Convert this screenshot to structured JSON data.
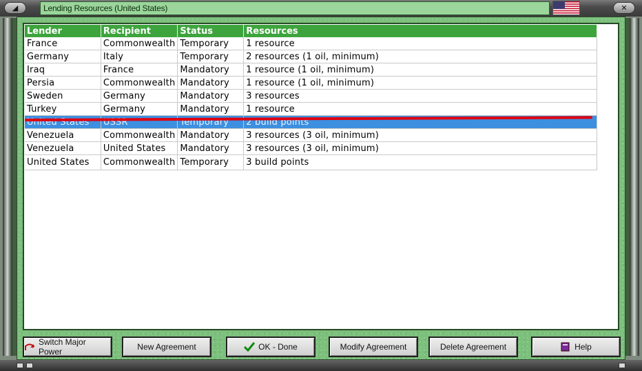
{
  "window": {
    "title": "Lending Resources (United States)",
    "left_button_icon": "window-menu-icon",
    "right_button_icon": "close-icon",
    "flag_icon": "us-flag-icon"
  },
  "table": {
    "headers": [
      "Lender",
      "Recipient",
      "Status",
      "Resources"
    ],
    "rows": [
      {
        "lender": "France",
        "recipient": "Commonwealth",
        "status": "Temporary",
        "resources": "1 resource"
      },
      {
        "lender": "Germany",
        "recipient": "Italy",
        "status": "Temporary",
        "resources": "2 resources (1 oil, minimum)"
      },
      {
        "lender": "Iraq",
        "recipient": "France",
        "status": "Mandatory",
        "resources": "1 resource (1 oil, minimum)"
      },
      {
        "lender": "Persia",
        "recipient": "Commonwealth",
        "status": "Mandatory",
        "resources": "1 resource (1 oil, minimum)"
      },
      {
        "lender": "Sweden",
        "recipient": "Germany",
        "status": "Mandatory",
        "resources": "3 resources"
      },
      {
        "lender": "Turkey",
        "recipient": "Germany",
        "status": "Mandatory",
        "resources": "1 resource"
      },
      {
        "lender": "United States",
        "recipient": "USSR",
        "status": "Temporary",
        "resources": "2 build points",
        "selected": true
      },
      {
        "lender": "Venezuela",
        "recipient": "Commonwealth",
        "status": "Mandatory",
        "resources": "3 resources (3 oil, minimum)"
      },
      {
        "lender": "Venezuela",
        "recipient": "United States",
        "status": "Mandatory",
        "resources": "3 resources (3 oil, minimum)"
      },
      {
        "lender": "United States",
        "recipient": "Commonwealth",
        "status": "Temporary",
        "resources": "3 build points"
      }
    ]
  },
  "buttons": {
    "switch": {
      "label": "Switch Major Power",
      "icon": "switch-power-icon"
    },
    "new": {
      "label": "New Agreement"
    },
    "ok": {
      "label": "OK - Done",
      "icon": "checkmark-icon"
    },
    "modify": {
      "label": "Modify Agreement"
    },
    "delete": {
      "label": "Delete Agreement"
    },
    "help": {
      "label": "Help",
      "icon": "help-book-icon"
    }
  },
  "colors": {
    "header_bg": "#3da43d",
    "selected_row_bg": "#3d8fe0",
    "annotation_line": "#e00010",
    "panel_green": "#7dbf7d"
  }
}
